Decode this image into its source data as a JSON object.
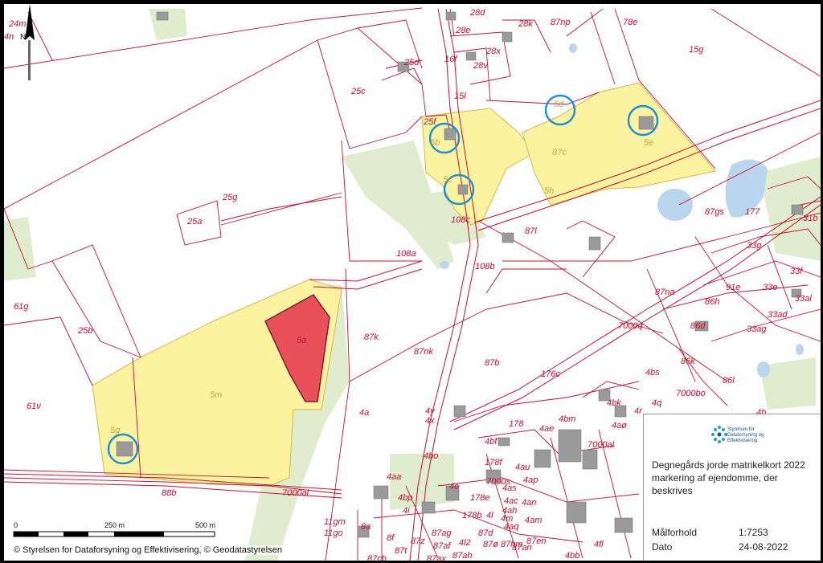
{
  "map": {
    "parcels_outside": [
      "24m",
      "4n",
      "28d",
      "28e",
      "28k",
      "87np",
      "78e",
      "25d",
      "16f",
      "28x",
      "28v",
      "15g",
      "25c",
      "15l",
      "25f",
      "25g",
      "25a",
      "108a",
      "108b",
      "87l",
      "33g",
      "33f",
      "33e",
      "91e",
      "87na",
      "86h",
      "33al",
      "33ad",
      "33ag",
      "86d",
      "86k",
      "7000q",
      "86l",
      "61g",
      "25b",
      "87k",
      "87nk",
      "87b",
      "176c",
      "4bs",
      "7000bo",
      "61v",
      "4a",
      "4y",
      "4x",
      "178",
      "4ae",
      "4bm",
      "4bk",
      "4r",
      "4q",
      "4aø",
      "7000al",
      "4bo",
      "4bf",
      "4b",
      "178f",
      "4au",
      "4ap",
      "4as",
      "4aa",
      "88b",
      "7000ai",
      "7000s",
      "178e",
      "4ac",
      "4an",
      "4ah",
      "4l",
      "4m",
      "178b",
      "4bp",
      "4i",
      "4e",
      "11gm",
      "11go",
      "8a",
      "8f",
      "87z",
      "87ag",
      "87d",
      "4am",
      "4aq",
      "87ø",
      "87af",
      "4l2",
      "87t",
      "87ah",
      "87an",
      "87hm",
      "87en",
      "87ax",
      "87cb",
      "4bb",
      "4fl",
      "31b",
      "177",
      "87gs",
      "108c"
    ],
    "owned_parcels": [
      "5b",
      "5c",
      "5d",
      "5e",
      "5h",
      "87c",
      "5m",
      "5g",
      "5a"
    ]
  },
  "north_arrow": {
    "label": "N"
  },
  "scale_bar": {
    "labels": [
      "0",
      "250 m",
      "500 m"
    ]
  },
  "legend": {
    "logo_text": "Styrelsen for Dataforsyning og Effektivisering",
    "title": "Degnegårds jorde matrikelkort 2022 markering af ejendomme, der beskrives",
    "rows": [
      {
        "label": "Målforhold",
        "value": "1:7253"
      },
      {
        "label": "Dato",
        "value": "24-08-2022"
      }
    ]
  },
  "copyright": "© Styrelsen for Dataforsyning og Effektivisering, © Geodatastyrelsen",
  "colors": {
    "parcel_line": "#c8102e",
    "owned_fill": "#fbf3a0",
    "highlight_fill": "#e9505a",
    "circle": "#1a8fd6",
    "green": "#dfeccd",
    "water": "#b9d6ee"
  }
}
